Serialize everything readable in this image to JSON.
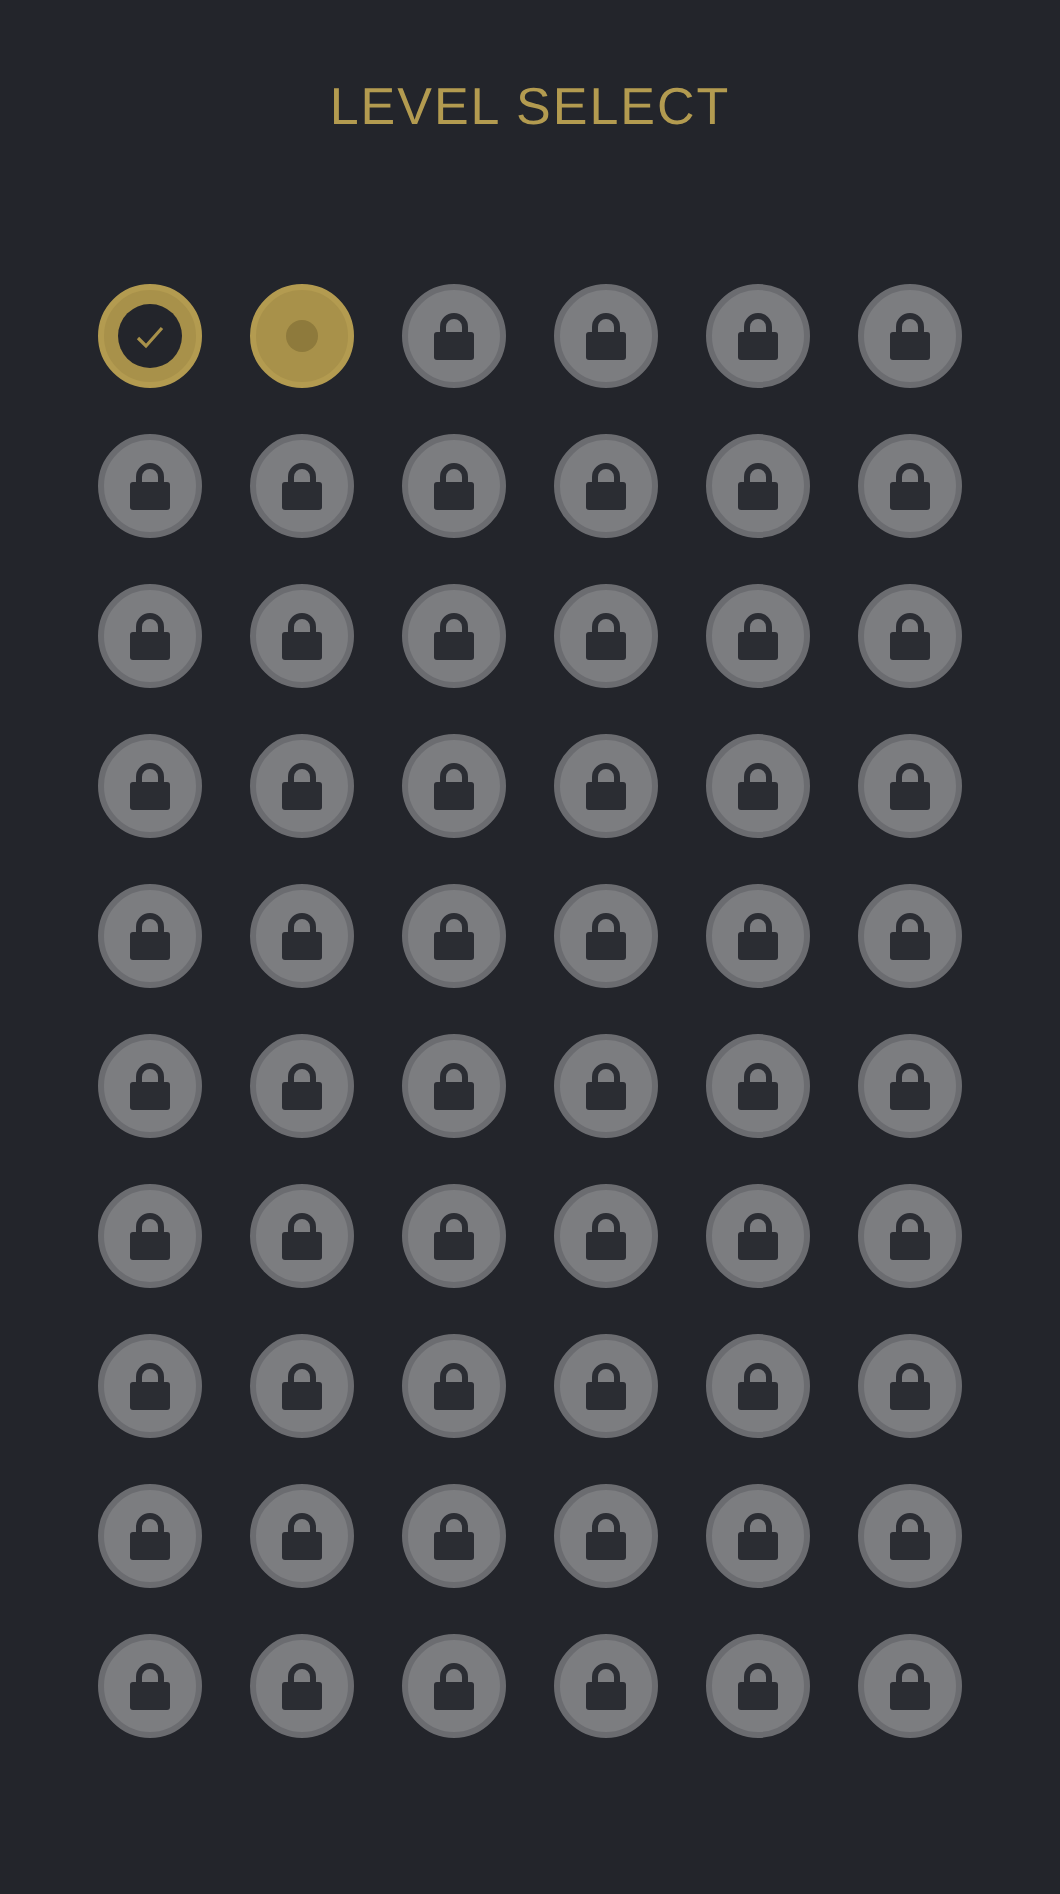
{
  "title": "LEVEL SELECT",
  "levels": [
    {
      "kind": "completed"
    },
    {
      "kind": "current"
    },
    {
      "kind": "locked"
    },
    {
      "kind": "locked"
    },
    {
      "kind": "locked"
    },
    {
      "kind": "locked"
    },
    {
      "kind": "locked"
    },
    {
      "kind": "locked"
    },
    {
      "kind": "locked"
    },
    {
      "kind": "locked"
    },
    {
      "kind": "locked"
    },
    {
      "kind": "locked"
    },
    {
      "kind": "locked"
    },
    {
      "kind": "locked"
    },
    {
      "kind": "locked"
    },
    {
      "kind": "locked"
    },
    {
      "kind": "locked"
    },
    {
      "kind": "locked"
    },
    {
      "kind": "locked"
    },
    {
      "kind": "locked"
    },
    {
      "kind": "locked"
    },
    {
      "kind": "locked"
    },
    {
      "kind": "locked"
    },
    {
      "kind": "locked"
    },
    {
      "kind": "locked"
    },
    {
      "kind": "locked"
    },
    {
      "kind": "locked"
    },
    {
      "kind": "locked"
    },
    {
      "kind": "locked"
    },
    {
      "kind": "locked"
    },
    {
      "kind": "locked"
    },
    {
      "kind": "locked"
    },
    {
      "kind": "locked"
    },
    {
      "kind": "locked"
    },
    {
      "kind": "locked"
    },
    {
      "kind": "locked"
    },
    {
      "kind": "locked"
    },
    {
      "kind": "locked"
    },
    {
      "kind": "locked"
    },
    {
      "kind": "locked"
    },
    {
      "kind": "locked"
    },
    {
      "kind": "locked"
    },
    {
      "kind": "locked"
    },
    {
      "kind": "locked"
    },
    {
      "kind": "locked"
    },
    {
      "kind": "locked"
    },
    {
      "kind": "locked"
    },
    {
      "kind": "locked"
    },
    {
      "kind": "locked"
    },
    {
      "kind": "locked"
    },
    {
      "kind": "locked"
    },
    {
      "kind": "locked"
    },
    {
      "kind": "locked"
    },
    {
      "kind": "locked"
    },
    {
      "kind": "locked"
    },
    {
      "kind": "locked"
    },
    {
      "kind": "locked"
    },
    {
      "kind": "locked"
    },
    {
      "kind": "locked"
    },
    {
      "kind": "locked"
    }
  ]
}
